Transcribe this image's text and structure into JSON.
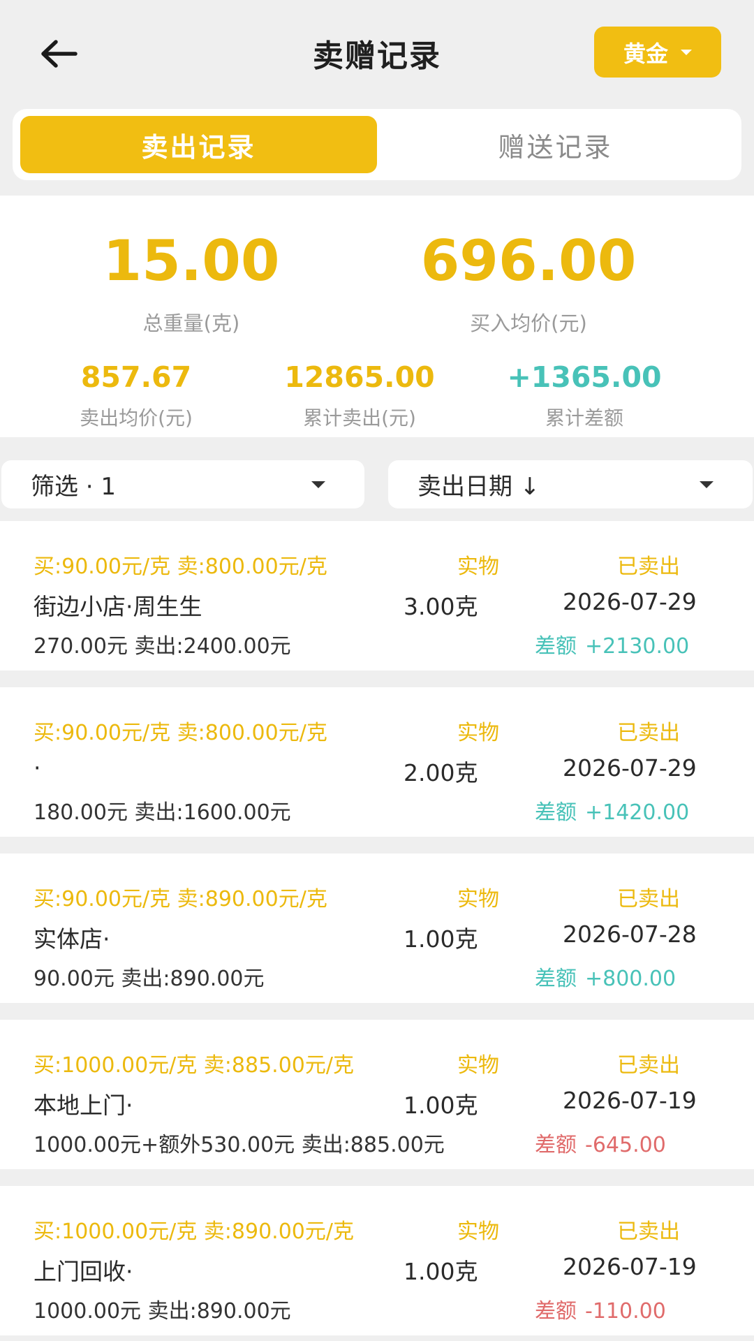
{
  "header": {
    "title": "卖赠记录",
    "metal_select": "黄金"
  },
  "tabs": [
    {
      "label": "卖出记录",
      "active": true
    },
    {
      "label": "赠送记录",
      "active": false
    }
  ],
  "summary": {
    "total_weight": {
      "value": "15.00",
      "label": "总重量(克)"
    },
    "avg_buy_price": {
      "value": "696.00",
      "label": "买入均价(元)"
    },
    "avg_sell_price": {
      "value": "857.67",
      "label": "卖出均价(元)"
    },
    "total_sold": {
      "value": "12865.00",
      "label": "累计卖出(元)"
    },
    "total_diff": {
      "value": "+1365.00",
      "label": "累计差额"
    }
  },
  "filters": {
    "filter_label": "筛选 · 1",
    "sort_label": "卖出日期 ↓"
  },
  "records": [
    {
      "price_line": "买:90.00元/克  卖:800.00元/克",
      "type": "实物",
      "status": "已卖出",
      "name": "街边小店·周生生",
      "weight": "3.00克",
      "date": "2026-07-29",
      "amounts": "270.00元 卖出:2400.00元",
      "diff_label": "差额",
      "diff_value": "+2130.00"
    },
    {
      "price_line": "买:90.00元/克  卖:800.00元/克",
      "type": "实物",
      "status": "已卖出",
      "name": "·",
      "weight": "2.00克",
      "date": "2026-07-29",
      "amounts": "180.00元 卖出:1600.00元",
      "diff_label": "差额",
      "diff_value": "+1420.00"
    },
    {
      "price_line": "买:90.00元/克  卖:890.00元/克",
      "type": "实物",
      "status": "已卖出",
      "name": "实体店·",
      "weight": "1.00克",
      "date": "2026-07-28",
      "amounts": "90.00元 卖出:890.00元",
      "diff_label": "差额",
      "diff_value": "+800.00"
    },
    {
      "price_line": "买:1000.00元/克  卖:885.00元/克",
      "type": "实物",
      "status": "已卖出",
      "name": "本地上门·",
      "weight": "1.00克",
      "date": "2026-07-19",
      "amounts": "1000.00元+额外530.00元 卖出:885.00元",
      "diff_label": "差额",
      "diff_value": "-645.00"
    },
    {
      "price_line": "买:1000.00元/克  卖:890.00元/克",
      "type": "实物",
      "status": "已卖出",
      "name": "上门回收·",
      "weight": "1.00克",
      "date": "2026-07-19",
      "amounts": "1000.00元 卖出:890.00元",
      "diff_label": "差额",
      "diff_value": "-110.00"
    }
  ]
}
